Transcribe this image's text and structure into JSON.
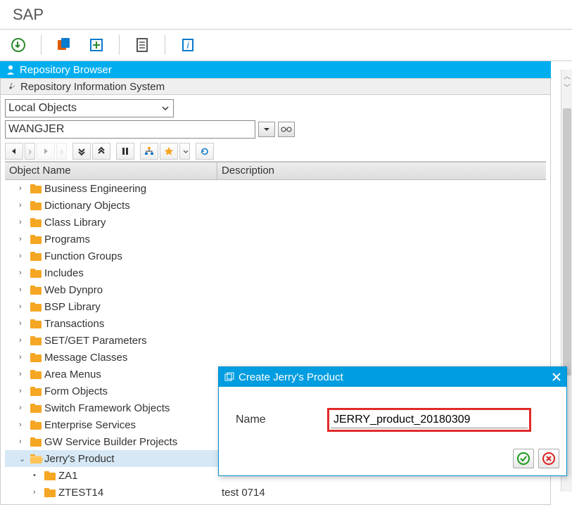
{
  "title": "SAP",
  "browser": {
    "tab_active": "Repository Browser",
    "tab_inactive": "Repository Information System",
    "scope_selector": "Local Objects",
    "user_field": "WANGJER"
  },
  "tree": {
    "col_name": "Object Name",
    "col_desc": "Description",
    "items": [
      {
        "label": "Business Engineering",
        "desc": ""
      },
      {
        "label": "Dictionary Objects",
        "desc": ""
      },
      {
        "label": "Class Library",
        "desc": ""
      },
      {
        "label": "Programs",
        "desc": ""
      },
      {
        "label": "Function Groups",
        "desc": ""
      },
      {
        "label": "Includes",
        "desc": ""
      },
      {
        "label": "Web Dynpro",
        "desc": ""
      },
      {
        "label": "BSP Library",
        "desc": ""
      },
      {
        "label": "Transactions",
        "desc": ""
      },
      {
        "label": "SET/GET Parameters",
        "desc": ""
      },
      {
        "label": "Message Classes",
        "desc": ""
      },
      {
        "label": "Area Menus",
        "desc": ""
      },
      {
        "label": "Form Objects",
        "desc": ""
      },
      {
        "label": "Switch Framework Objects",
        "desc": ""
      },
      {
        "label": "Enterprise Services",
        "desc": ""
      },
      {
        "label": "GW Service Builder Projects",
        "desc": ""
      }
    ],
    "selected": {
      "label": "Jerry's Product",
      "desc": ""
    },
    "children": [
      {
        "label": "ZA1",
        "desc": ""
      },
      {
        "label": "ZTEST14",
        "desc": "test 0714"
      }
    ]
  },
  "dialog": {
    "title": "Create Jerry's Product",
    "field_label": "Name",
    "field_value": "JERRY_product_20180309"
  }
}
